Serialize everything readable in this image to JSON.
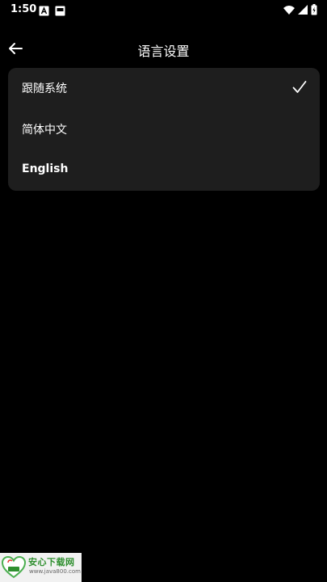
{
  "status_bar": {
    "time": "1:50",
    "left_icons": [
      "accessibility-a-icon",
      "screen-cast-icon"
    ],
    "right_icons": [
      "wifi-icon",
      "signal-icon",
      "battery-charging-icon"
    ]
  },
  "app_bar": {
    "title": "语言设置",
    "back_icon": "arrow-left-icon"
  },
  "language_options": [
    {
      "label": "跟随系统",
      "selected": true
    },
    {
      "label": "简体中文",
      "selected": false
    },
    {
      "label": "English",
      "selected": false
    }
  ],
  "watermark": {
    "title": "安心下载网",
    "url": "www.java800.com"
  },
  "colors": {
    "background": "#000000",
    "card": "#1e1e1e",
    "text": "#ffffff",
    "watermark_green": "#2f8f2f"
  }
}
